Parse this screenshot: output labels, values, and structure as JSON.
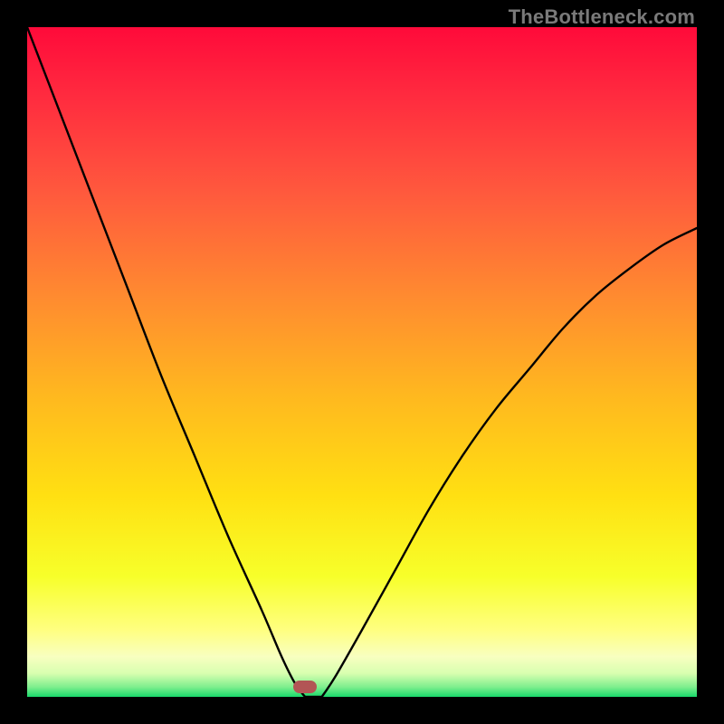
{
  "watermark": {
    "text": "TheBottleneck.com"
  },
  "gradient": {
    "stops": [
      {
        "offset": 0,
        "color": "#ff0a3a"
      },
      {
        "offset": 0.1,
        "color": "#ff2a3f"
      },
      {
        "offset": 0.25,
        "color": "#ff5a3d"
      },
      {
        "offset": 0.4,
        "color": "#ff8a30"
      },
      {
        "offset": 0.55,
        "color": "#ffb81f"
      },
      {
        "offset": 0.7,
        "color": "#ffe012"
      },
      {
        "offset": 0.82,
        "color": "#f7ff2a"
      },
      {
        "offset": 0.9,
        "color": "#ffff80"
      },
      {
        "offset": 0.94,
        "color": "#f8ffc0"
      },
      {
        "offset": 0.965,
        "color": "#d8ffb0"
      },
      {
        "offset": 0.985,
        "color": "#80ef8e"
      },
      {
        "offset": 1.0,
        "color": "#19d96b"
      }
    ]
  },
  "marker": {
    "x_frac": 0.415,
    "y_frac": 0.985,
    "color": "#b25555"
  },
  "chart_data": {
    "type": "line",
    "title": "",
    "xlabel": "",
    "ylabel": "",
    "xlim": [
      0,
      100
    ],
    "ylim": [
      0,
      100
    ],
    "series": [
      {
        "name": "left-arm",
        "x": [
          0,
          5,
          10,
          15,
          20,
          25,
          30,
          35,
          38,
          40,
          41.5
        ],
        "y": [
          100,
          87,
          74,
          61,
          48,
          36,
          24,
          13,
          6,
          2,
          0
        ]
      },
      {
        "name": "right-arm",
        "x": [
          44,
          46,
          50,
          55,
          60,
          65,
          70,
          75,
          80,
          85,
          90,
          95,
          100
        ],
        "y": [
          0,
          3,
          10,
          19,
          28,
          36,
          43,
          49,
          55,
          60,
          64,
          67.5,
          70
        ]
      }
    ],
    "flat_segment": {
      "x": [
        41.5,
        44
      ],
      "y": [
        0,
        0
      ]
    },
    "optimum_marker": {
      "x": 41.5,
      "y": 1.5
    }
  }
}
